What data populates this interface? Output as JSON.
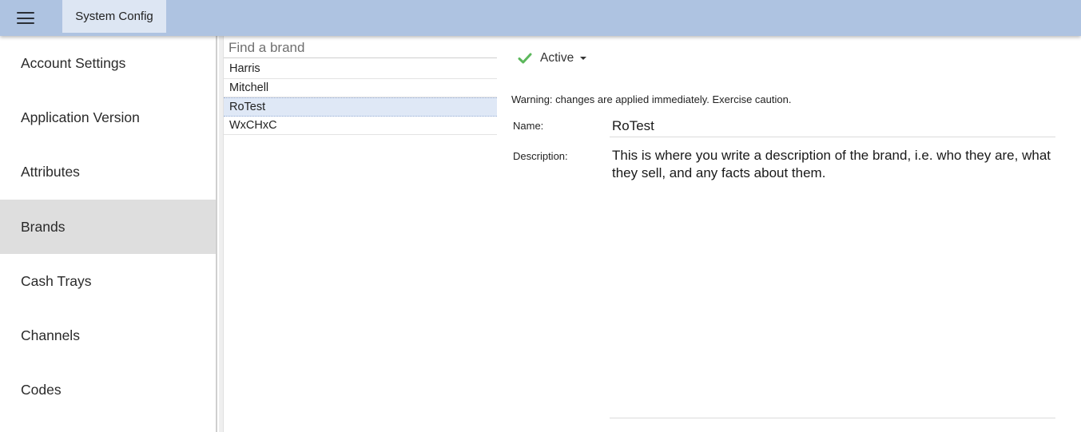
{
  "header": {
    "app_title": "System Config",
    "menu_icon": "hamburger-menu-icon",
    "background": "#aec3e1"
  },
  "sidebar": {
    "items": [
      {
        "label": "Account Settings"
      },
      {
        "label": "Application Version"
      },
      {
        "label": "Attributes"
      },
      {
        "label": "Brands",
        "active": true
      },
      {
        "label": "Cash Trays"
      },
      {
        "label": "Channels"
      },
      {
        "label": "Codes"
      }
    ]
  },
  "brands": {
    "search_placeholder": "Find a brand",
    "items": [
      {
        "name": "Harris"
      },
      {
        "name": "Mitchell"
      },
      {
        "name": "RoTest",
        "selected": true
      },
      {
        "name": "WxCHxC"
      }
    ]
  },
  "detail": {
    "status": {
      "label": "Active",
      "icon": "checkmark-icon",
      "icon_color": "#5cb85c"
    },
    "warning": "Warning: changes are applied immediately. Exercise caution.",
    "name_label": "Name:",
    "name_value": "RoTest",
    "description_label": "Description:",
    "description_value": "This is where you write a description of the brand, i.e. who they are, what they sell, and any facts about them."
  }
}
